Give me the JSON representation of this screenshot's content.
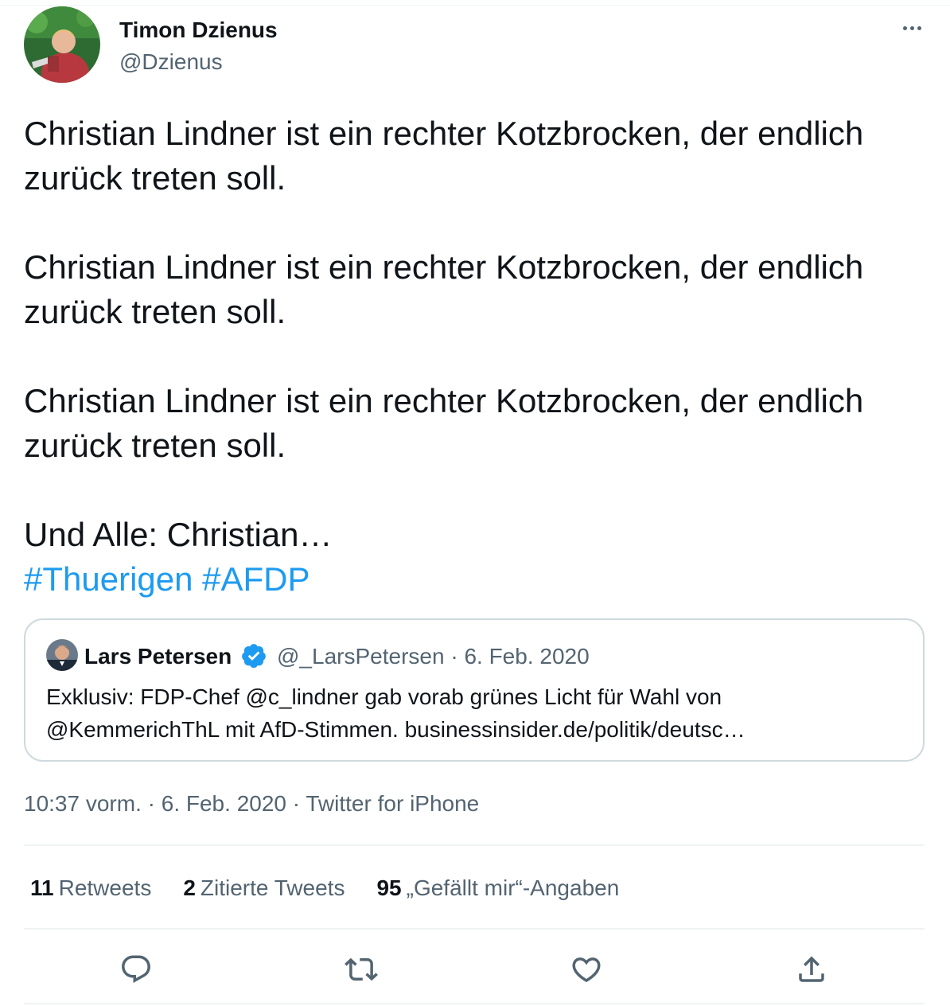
{
  "tweet": {
    "author_name": "Timon Dzienus",
    "author_handle": "@Dzienus",
    "paragraphs": [
      "Christian Lindner ist ein rechter Kotzbrocken, der endlich zurück treten soll.",
      "Christian Lindner ist ein rechter Kotzbrocken, der endlich zurück treten soll.",
      "Christian Lindner ist ein rechter Kotzbrocken, der endlich zurück treten soll.",
      "Und Alle: Christian…"
    ],
    "hashtags": [
      "#Thuerigen",
      "#AFDP"
    ],
    "time": "10:37 vorm.",
    "date": "6. Feb. 2020",
    "source": "Twitter for iPhone",
    "separator": " · "
  },
  "quote": {
    "author_name": "Lars Petersen",
    "author_handle": "@_LarsPetersen",
    "date": "6. Feb. 2020",
    "separator": " · ",
    "text_line1": "Exklusiv: FDP-Chef @c_lindner gab vorab grünes Licht für Wahl von",
    "text_line2": "@KemmerichThL mit AfD-Stimmen. businessinsider.de/politik/deutsc…"
  },
  "stats": {
    "retweets_count": "11",
    "retweets_label": "Retweets",
    "quotes_count": "2",
    "quotes_label": "Zitierte Tweets",
    "likes_count": "95",
    "likes_label": "„Gefällt mir“-Angaben"
  },
  "actions": {
    "reply_icon": "reply-icon",
    "retweet_icon": "retweet-icon",
    "like_icon": "heart-icon",
    "share_icon": "share-icon"
  },
  "colors": {
    "text": "#0f1419",
    "secondary": "#536471",
    "link": "#1d9bf0",
    "border": "#cfd9de"
  }
}
